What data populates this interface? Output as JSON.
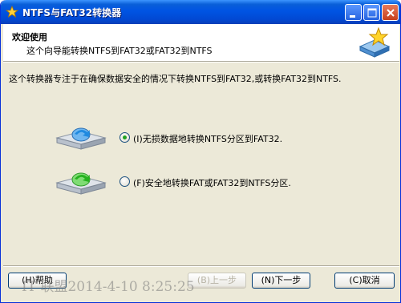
{
  "window": {
    "title": "NTFS与FAT32转换器",
    "controls": [
      "minimize",
      "maximize",
      "close"
    ]
  },
  "header": {
    "title": "欢迎使用",
    "subtitle": "这个向导能转换NTFS到FAT32或FAT32到NTFS",
    "icon": "star-drive-icon"
  },
  "description": "这个转换器专注于在确保数据安全的情况下转换NTFS到FAT32,或转换FAT32到NTFS.",
  "options": [
    {
      "label": "(I)无损数据地转换NTFS分区到FAT32.",
      "selected": true,
      "icon": "drive-blue-arrow-icon"
    },
    {
      "label": "(F)安全地转换FAT或FAT32到NTFS分区.",
      "selected": false,
      "icon": "drive-green-arrow-icon"
    }
  ],
  "buttons": {
    "help": "(H)帮助",
    "back": "(B)上一步",
    "next": "(N)下一步",
    "cancel": "(C)取消"
  },
  "watermark": "IT 联盟2014-4-10 8:25:25",
  "colors": {
    "titlebar": "#0054e3",
    "dialog_bg": "#ece9d8",
    "radio_dot": "#21a121",
    "close_button": "#c6401c"
  }
}
